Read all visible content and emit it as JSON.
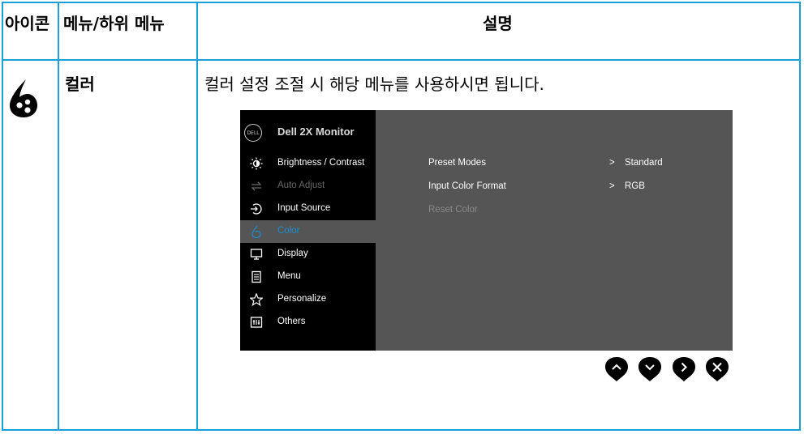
{
  "table": {
    "headers": {
      "icon": "아이콘",
      "menu": "메뉴/하위 메뉴",
      "desc": "설명"
    },
    "row": {
      "menu_name": "컬러",
      "description": "컬러 설정 조절 시 해당 메뉴를 사용하시면 됩니다."
    },
    "border_color": "#1a9fd9"
  },
  "osd": {
    "logo_text": "DELL",
    "title": "Dell 2X Monitor",
    "menu": [
      {
        "label": "Brightness / Contrast",
        "icon": "brightness-icon",
        "state": "normal"
      },
      {
        "label": "Auto Adjust",
        "icon": "auto-adjust-icon",
        "state": "disabled"
      },
      {
        "label": "Input Source",
        "icon": "input-source-icon",
        "state": "normal"
      },
      {
        "label": "Color",
        "icon": "color-icon",
        "state": "selected"
      },
      {
        "label": "Display",
        "icon": "display-icon",
        "state": "normal"
      },
      {
        "label": "Menu",
        "icon": "menu-icon",
        "state": "normal"
      },
      {
        "label": "Personalize",
        "icon": "star-icon",
        "state": "normal"
      },
      {
        "label": "Others",
        "icon": "others-icon",
        "state": "normal"
      }
    ],
    "options": [
      {
        "label": "Preset Modes",
        "arrow": ">",
        "value": "Standard",
        "state": "normal"
      },
      {
        "label": "Input Color Format",
        "arrow": ">",
        "value": "RGB",
        "state": "normal"
      },
      {
        "label": "Reset Color",
        "arrow": "",
        "value": "",
        "state": "disabled"
      }
    ],
    "accent_color": "#1a8fd0"
  },
  "nav_buttons": [
    "up-icon",
    "down-icon",
    "right-icon",
    "close-icon"
  ]
}
